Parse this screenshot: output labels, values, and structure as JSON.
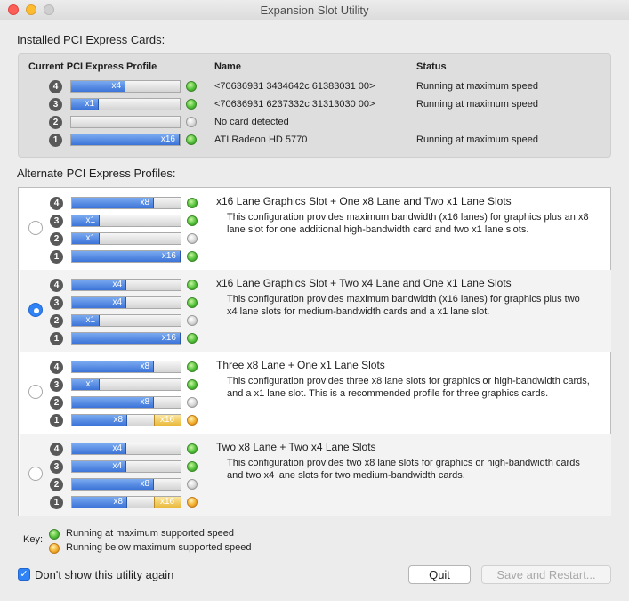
{
  "window": {
    "title": "Expansion Slot Utility"
  },
  "installed": {
    "section_label": "Installed PCI Express Cards:",
    "col_profile": "Current PCI Express Profile",
    "col_name": "Name",
    "col_status": "Status",
    "rows": [
      {
        "slot": "4",
        "lanes_label": "x4",
        "fill_fraction": 0.5,
        "led": "green",
        "name": "<70636931 3434642c 61383031 00>",
        "status": "Running at maximum speed"
      },
      {
        "slot": "3",
        "lanes_label": "x1",
        "fill_fraction": 0.25,
        "led": "green",
        "name": "<70636931 6237332c 31313030 00>",
        "status": "Running at maximum speed"
      },
      {
        "slot": "2",
        "lanes_label": "",
        "fill_fraction": 0,
        "led": "gray",
        "name": "No card detected",
        "status": ""
      },
      {
        "slot": "1",
        "lanes_label": "x16",
        "fill_fraction": 1.0,
        "led": "green",
        "name": "ATI Radeon HD 5770",
        "status": "Running at maximum speed"
      }
    ]
  },
  "alternate": {
    "section_label": "Alternate PCI Express Profiles:",
    "profiles": [
      {
        "selected": false,
        "title": "x16 Lane Graphics Slot + One x8 Lane and Two x1 Lane Slots",
        "description": "This configuration provides maximum bandwidth (x16 lanes) for graphics plus an x8 lane slot for one additional high-bandwidth card and two x1 lane slots.",
        "slots": [
          {
            "slot": "4",
            "lanes_label": "x8",
            "fill_fraction": 0.75,
            "max_label": "",
            "led": "green"
          },
          {
            "slot": "3",
            "lanes_label": "x1",
            "fill_fraction": 0.25,
            "max_label": "",
            "led": "green"
          },
          {
            "slot": "2",
            "lanes_label": "x1",
            "fill_fraction": 0.25,
            "max_label": "",
            "led": "gray"
          },
          {
            "slot": "1",
            "lanes_label": "x16",
            "fill_fraction": 1.0,
            "max_label": "",
            "led": "green"
          }
        ]
      },
      {
        "selected": true,
        "title": "x16 Lane Graphics Slot + Two x4 Lane and One x1 Lane Slots",
        "description": "This configuration provides maximum bandwidth (x16 lanes) for graphics plus two x4 lane slots for medium-bandwidth cards and a x1 lane slot.",
        "slots": [
          {
            "slot": "4",
            "lanes_label": "x4",
            "fill_fraction": 0.5,
            "max_label": "",
            "led": "green"
          },
          {
            "slot": "3",
            "lanes_label": "x4",
            "fill_fraction": 0.5,
            "max_label": "",
            "led": "green"
          },
          {
            "slot": "2",
            "lanes_label": "x1",
            "fill_fraction": 0.25,
            "max_label": "",
            "led": "gray"
          },
          {
            "slot": "1",
            "lanes_label": "x16",
            "fill_fraction": 1.0,
            "max_label": "",
            "led": "green"
          }
        ]
      },
      {
        "selected": false,
        "title": "Three x8 Lane + One x1 Lane Slots",
        "description": "This configuration provides three x8 lane slots for graphics or high-bandwidth cards, and a x1 lane slot.  This is a recommended profile for three graphics cards.",
        "slots": [
          {
            "slot": "4",
            "lanes_label": "x8",
            "fill_fraction": 0.75,
            "max_label": "",
            "led": "green"
          },
          {
            "slot": "3",
            "lanes_label": "x1",
            "fill_fraction": 0.25,
            "max_label": "",
            "led": "green"
          },
          {
            "slot": "2",
            "lanes_label": "x8",
            "fill_fraction": 0.75,
            "max_label": "",
            "led": "gray"
          },
          {
            "slot": "1",
            "lanes_label": "x8",
            "fill_fraction": 0.75,
            "max_label": "x16",
            "led": "orange"
          }
        ]
      },
      {
        "selected": false,
        "title": "Two x8 Lane + Two x4 Lane Slots",
        "description": "This configuration provides two x8 lane slots for graphics or high-bandwidth cards and two x4 lane slots for two medium-bandwidth cards.",
        "slots": [
          {
            "slot": "4",
            "lanes_label": "x4",
            "fill_fraction": 0.5,
            "max_label": "",
            "led": "green"
          },
          {
            "slot": "3",
            "lanes_label": "x4",
            "fill_fraction": 0.5,
            "max_label": "",
            "led": "green"
          },
          {
            "slot": "2",
            "lanes_label": "x8",
            "fill_fraction": 0.75,
            "max_label": "",
            "led": "gray"
          },
          {
            "slot": "1",
            "lanes_label": "x8",
            "fill_fraction": 0.75,
            "max_label": "x16",
            "led": "orange"
          }
        ]
      }
    ]
  },
  "key": {
    "label": "Key:",
    "items": [
      {
        "led": "green",
        "text": "Running at maximum supported speed"
      },
      {
        "led": "orange",
        "text": "Running below maximum supported speed"
      }
    ]
  },
  "footer": {
    "checkbox_checked": true,
    "checkbox_label": "Don't show this utility again",
    "quit_label": "Quit",
    "save_label": "Save and Restart..."
  },
  "colors": {
    "lane_fill": "#3c74d8",
    "max_seg": "#e9b83b",
    "led_green": "#53c23a",
    "led_orange": "#f3b02f",
    "selected_radio": "#2f83f6"
  }
}
